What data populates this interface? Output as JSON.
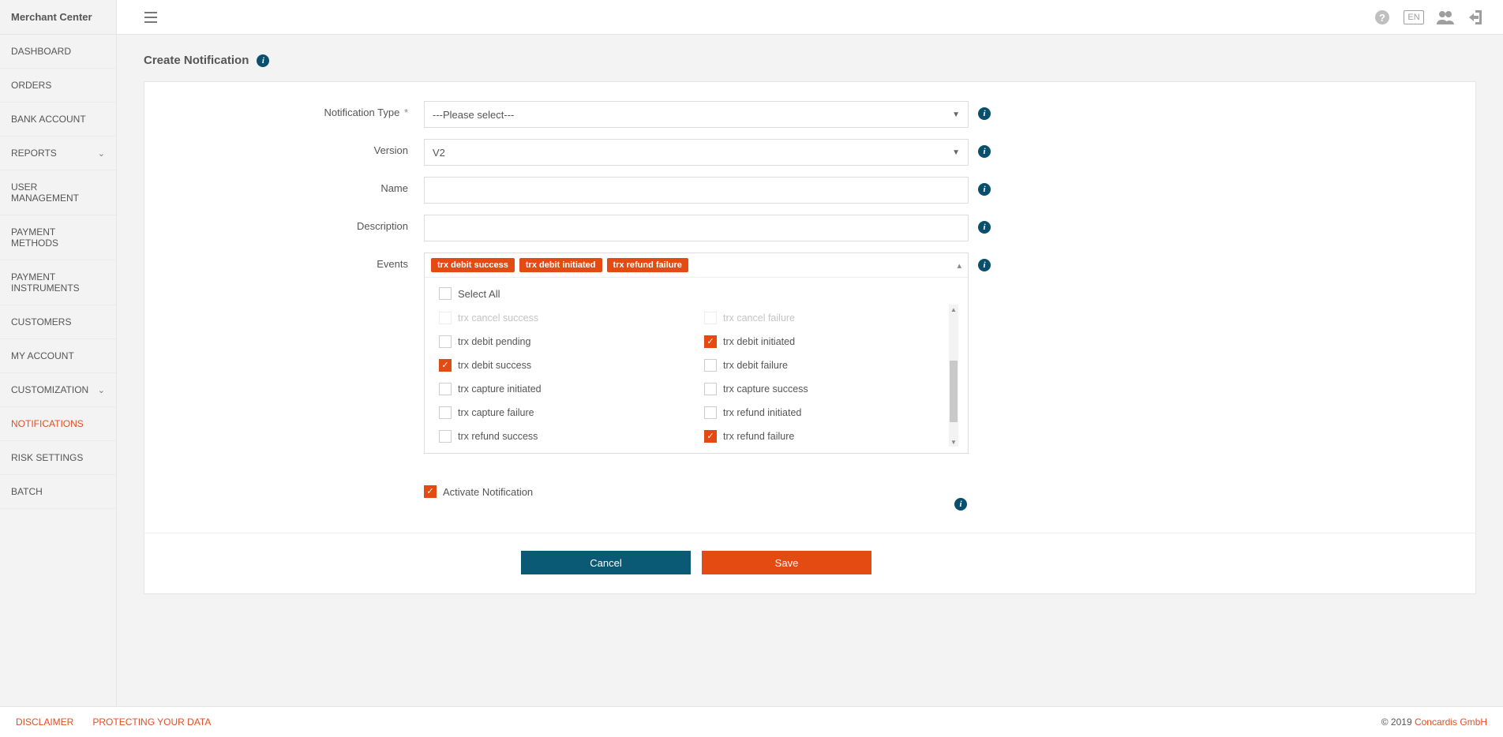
{
  "brand": "Merchant Center",
  "lang": "EN",
  "nav": {
    "items": [
      {
        "label": "DASHBOARD"
      },
      {
        "label": "ORDERS"
      },
      {
        "label": "BANK ACCOUNT"
      },
      {
        "label": "REPORTS",
        "expandable": true
      },
      {
        "label": "USER MANAGEMENT"
      },
      {
        "label": "PAYMENT METHODS"
      },
      {
        "label": "PAYMENT INSTRUMENTS"
      },
      {
        "label": "CUSTOMERS"
      },
      {
        "label": "MY ACCOUNT"
      },
      {
        "label": "CUSTOMIZATION",
        "expandable": true
      },
      {
        "label": "NOTIFICATIONS",
        "active": true
      },
      {
        "label": "RISK SETTINGS"
      },
      {
        "label": "BATCH"
      }
    ]
  },
  "page": {
    "title": "Create Notification",
    "labels": {
      "notification_type": "Notification Type",
      "version": "Version",
      "name": "Name",
      "description": "Description",
      "events": "Events",
      "activate": "Activate Notification",
      "cancel": "Cancel",
      "save": "Save",
      "select_all": "Select All"
    },
    "values": {
      "notification_type": "---Please select---",
      "version": "V2",
      "name": "",
      "description": "",
      "activate_checked": true
    },
    "selected_event_tags": [
      "trx debit success",
      "trx debit initiated",
      "trx refund failure"
    ],
    "event_options": [
      {
        "label": "trx cancel success",
        "checked": false,
        "faded": true
      },
      {
        "label": "trx cancel failure",
        "checked": false,
        "faded": true
      },
      {
        "label": "trx debit pending",
        "checked": false
      },
      {
        "label": "trx debit initiated",
        "checked": true
      },
      {
        "label": "trx debit success",
        "checked": true
      },
      {
        "label": "trx debit failure",
        "checked": false
      },
      {
        "label": "trx capture initiated",
        "checked": false
      },
      {
        "label": "trx capture success",
        "checked": false
      },
      {
        "label": "trx capture failure",
        "checked": false
      },
      {
        "label": "trx refund initiated",
        "checked": false
      },
      {
        "label": "trx refund success",
        "checked": false
      },
      {
        "label": "trx refund failure",
        "checked": true
      }
    ]
  },
  "footer": {
    "links": [
      "DISCLAIMER",
      "PROTECTING YOUR DATA"
    ],
    "copyright_prefix": "© 2019 ",
    "company": "Concardis GmbH"
  }
}
